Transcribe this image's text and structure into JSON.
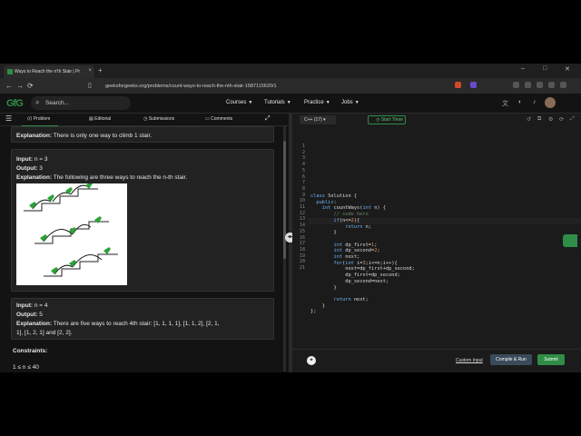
{
  "browser": {
    "tab_title": "Ways to Reach the n'th Stair | Pr",
    "tab_close": "×",
    "new_tab": "+",
    "window_controls": [
      "–",
      "□",
      "✕"
    ],
    "nav": {
      "back": "←",
      "forward": "→",
      "reload": "⟳"
    },
    "url": "geeksforgeeks.org/problems/count-ways-to-reach-the-nth-stair-1587115620/1"
  },
  "header": {
    "logo": "GfG",
    "search_placeholder": "Search...",
    "menu": [
      "Courses",
      "Tutorials",
      "Practice",
      "Jobs"
    ]
  },
  "left": {
    "tabs": [
      "Problem",
      "Editorial",
      "Submissions",
      "Comments"
    ],
    "ex1_explanation_label": "Explanation:",
    "ex1_explanation": "There is only one way to climb 1 stair.",
    "ex2": {
      "input_label": "Input:",
      "input": "n = 3",
      "output_label": "Output:",
      "output": "3",
      "explanation_label": "Explanation:",
      "explanation": "The following are three ways to reach the n-th stair."
    },
    "ex3": {
      "input_label": "Input:",
      "input": "n = 4",
      "output_label": "Output:",
      "output": "5",
      "explanation_label": "Explanation:",
      "explanation_line1": "There are five ways to reach 4th stair: [1, 1, 1, 1], [1, 1, 2], [2, 1,",
      "explanation_line2": "1], [1, 2, 1] and [2, 2]."
    },
    "constraints_label": "Constraints:",
    "constraint": "1 ≤ n ≤ 40"
  },
  "editor": {
    "language": "C++ (17)",
    "timer": "Start Timer",
    "line_numbers": [
      "1",
      "2",
      "3",
      "4",
      "5",
      "6",
      "7",
      "8",
      "9",
      "10",
      "11",
      "12",
      "13",
      "14",
      "15",
      "16",
      "17",
      "18",
      "19",
      "20",
      "21"
    ],
    "custom_input": "Custom Input",
    "compile_run": "Compile & Run",
    "submit": "Submit"
  },
  "colors": {
    "accent": "#2f8d46",
    "bg": "#131313",
    "card": "#222222"
  }
}
